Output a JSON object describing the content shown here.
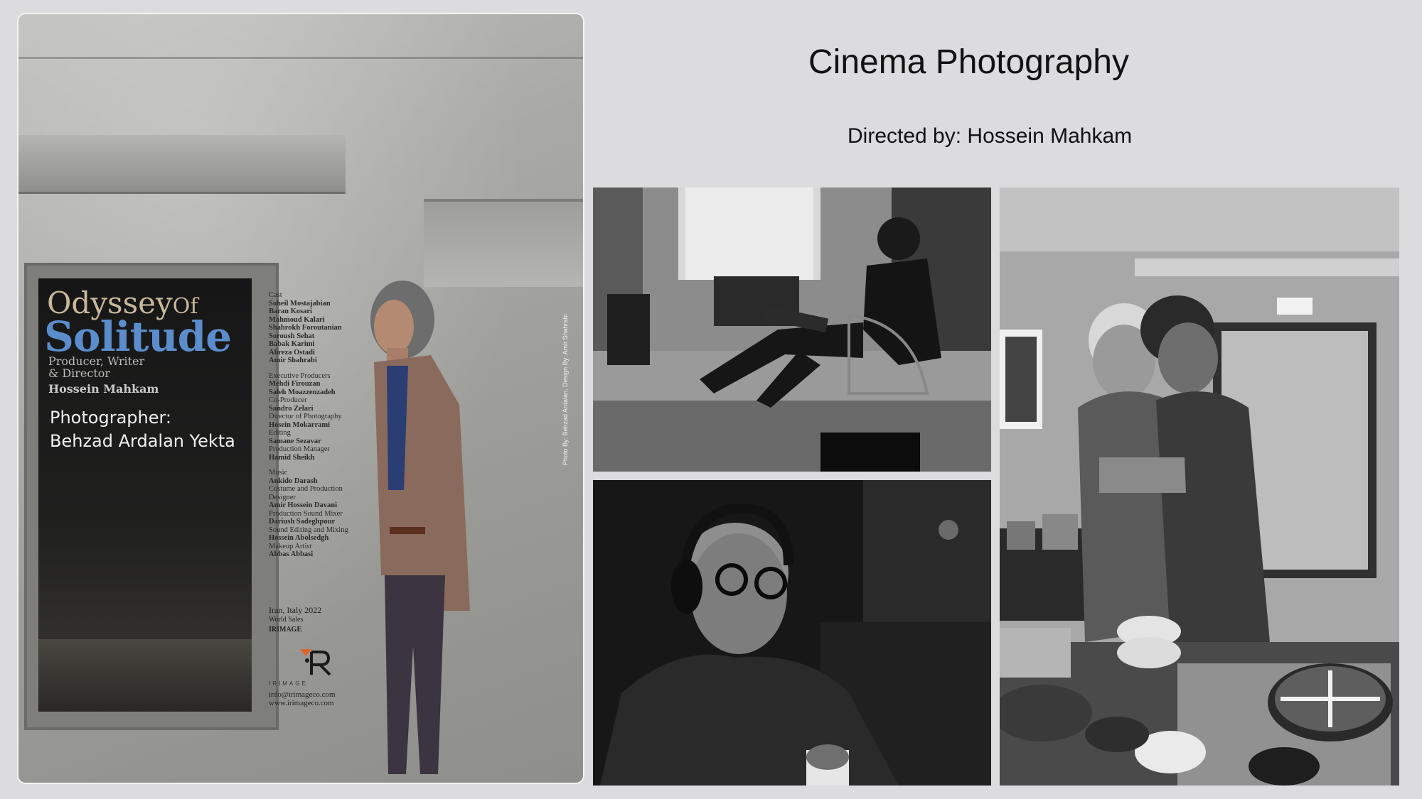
{
  "header": {
    "title": "Cinema Photography",
    "director_line": "Directed by: Hossein Mahkam"
  },
  "poster": {
    "title_line1": "Odyssey",
    "title_of": "Of",
    "title_line2": "Solitude",
    "role_line1": "Producer, Writer",
    "role_line2": "& Director",
    "director_name": "Hossein Mahkam",
    "photographer_label": "Photographer:",
    "photographer_name": "Behzad Ardalan Yekta",
    "credits": [
      {
        "text": "Cast",
        "bold": false
      },
      {
        "text": "Soheil Mostajabian",
        "bold": true
      },
      {
        "text": "Baran Kosari",
        "bold": true
      },
      {
        "text": "Mahmoud Kalari",
        "bold": true
      },
      {
        "text": "Shahrokh Foroutanian",
        "bold": true
      },
      {
        "text": "Soroush Sehat",
        "bold": true
      },
      {
        "text": "Babak Karimi",
        "bold": true
      },
      {
        "text": "Alireza Ostadi",
        "bold": true
      },
      {
        "text": "Amir Shahrabi",
        "bold": true
      },
      {
        "text": "",
        "bold": false
      },
      {
        "text": "Executive Producers",
        "bold": false
      },
      {
        "text": "Mehdi Firouzan",
        "bold": true
      },
      {
        "text": "Saleh Moazzenzadeh",
        "bold": true
      },
      {
        "text": "Co-Producer",
        "bold": false
      },
      {
        "text": "Sandro Zelari",
        "bold": true
      },
      {
        "text": "Director of Photography",
        "bold": false
      },
      {
        "text": "Hosein Mokarrami",
        "bold": true
      },
      {
        "text": "Editing",
        "bold": false
      },
      {
        "text": "Samane Sezavar",
        "bold": true
      },
      {
        "text": "Production Manager",
        "bold": false
      },
      {
        "text": "Hamid Sheikh",
        "bold": true
      },
      {
        "text": "",
        "bold": false
      },
      {
        "text": "Music",
        "bold": false
      },
      {
        "text": "Ankido Darash",
        "bold": true
      },
      {
        "text": "Costume and Production",
        "bold": false
      },
      {
        "text": "Designer",
        "bold": false
      },
      {
        "text": "Amir Hossein Davani",
        "bold": true
      },
      {
        "text": "Production Sound Mixer",
        "bold": false
      },
      {
        "text": "Dariush Sadeghpour",
        "bold": true
      },
      {
        "text": "Sound Editing and Mixing",
        "bold": false
      },
      {
        "text": "Hossein Abolsedgh",
        "bold": true
      },
      {
        "text": "Makeup Artist",
        "bold": false
      },
      {
        "text": "Abbas Abbasi",
        "bold": true
      }
    ],
    "release_line": "Iran, Italy 2022",
    "world_sales_label": "World Sales",
    "world_sales_name": "IRIMAGE",
    "logo_text": "IRIMAGE",
    "email": "info@irimageco.com",
    "website": "www.irimageco.com",
    "photo_credit": "Photo By: Behzad Ardalan, Design By: Amir Shahrabi"
  },
  "photos": [
    {
      "name": "man-reading-in-hallway"
    },
    {
      "name": "man-with-headphones"
    },
    {
      "name": "two-men-embracing-kitchen"
    }
  ]
}
